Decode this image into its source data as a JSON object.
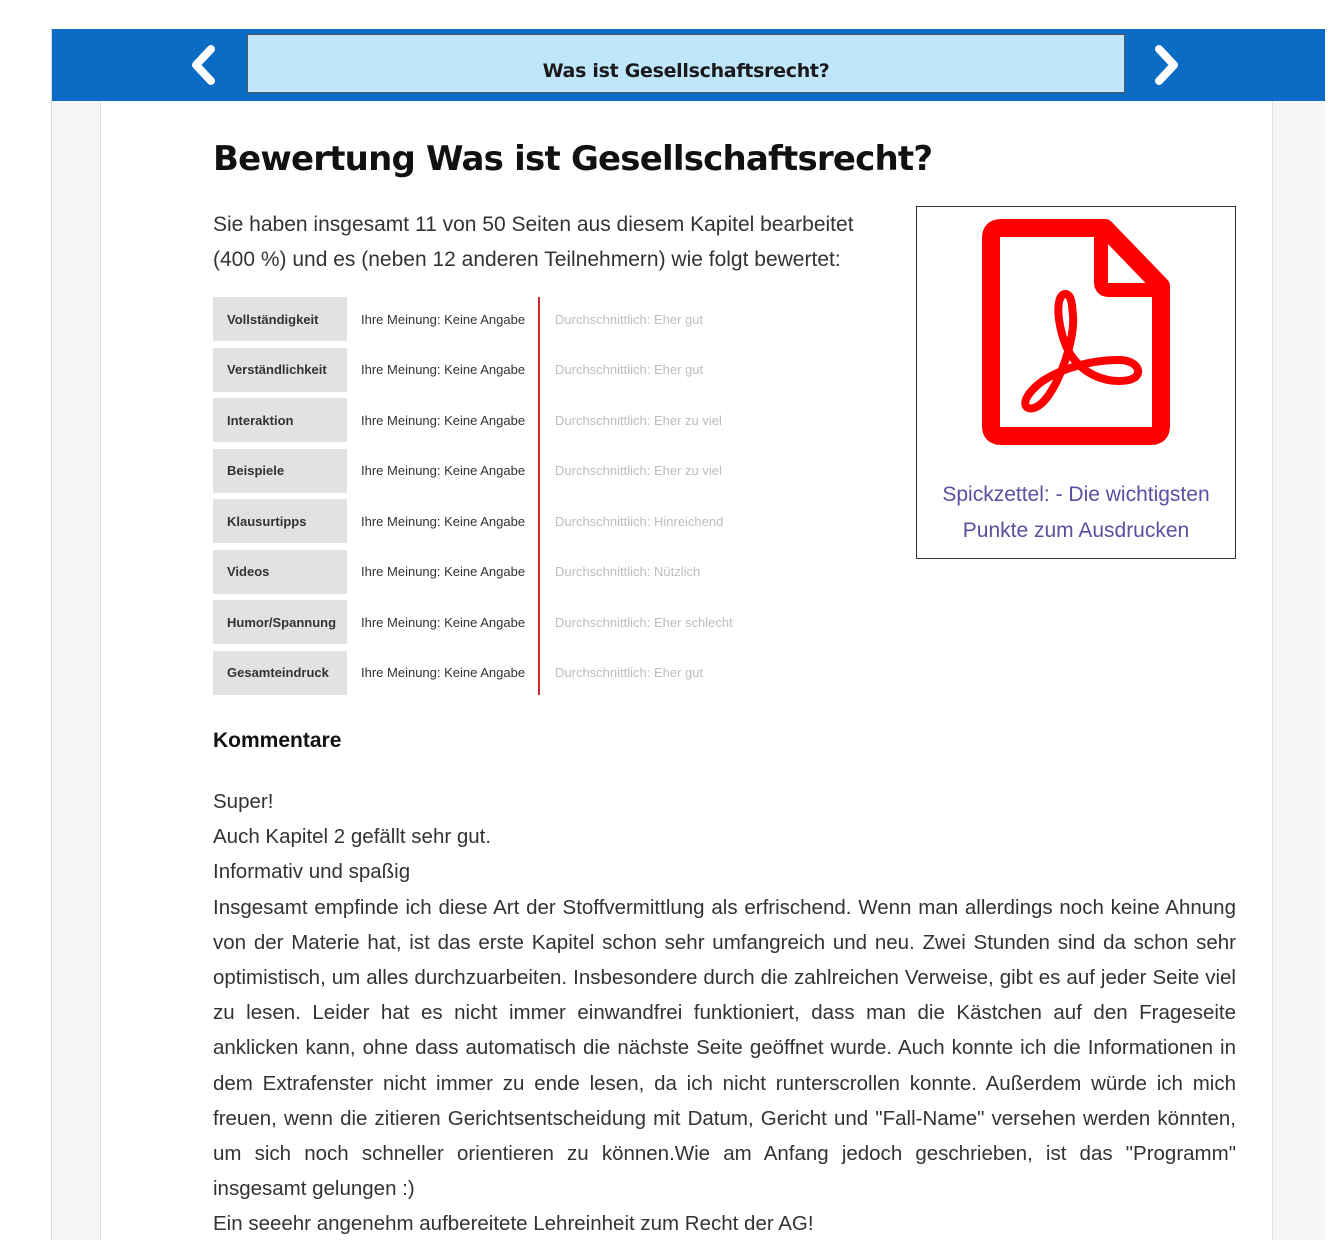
{
  "header": {
    "title": "Was ist Gesellschaftsrecht?",
    "prev_icon": "chevron-left-icon",
    "next_icon": "chevron-right-icon"
  },
  "page": {
    "heading": "Bewertung Was ist Gesellschaftsrecht?",
    "intro": "Sie haben insgesamt 11 von 50 Seiten aus diesem Kapitel bearbeitet (400 %) und es (neben 12 anderen Teilnehmern) wie folgt bewertet:"
  },
  "ratings": [
    {
      "label": "Vollständigkeit",
      "mine": "Ihre Meinung: Keine Angabe",
      "avg": "Durchschnittlich: Eher gut"
    },
    {
      "label": "Verständlichkeit",
      "mine": "Ihre Meinung: Keine Angabe",
      "avg": "Durchschnittlich: Eher gut"
    },
    {
      "label": "Interaktion",
      "mine": "Ihre Meinung: Keine Angabe",
      "avg": "Durchschnittlich: Eher zu viel"
    },
    {
      "label": "Beispiele",
      "mine": "Ihre Meinung: Keine Angabe",
      "avg": "Durchschnittlich: Eher zu viel"
    },
    {
      "label": "Klausurtipps",
      "mine": "Ihre Meinung: Keine Angabe",
      "avg": "Durchschnittlich: Hinreichend"
    },
    {
      "label": "Videos",
      "mine": "Ihre Meinung: Keine Angabe",
      "avg": "Durchschnittlich: Nützlich"
    },
    {
      "label": "Humor/Spannung",
      "mine": "Ihre Meinung: Keine Angabe",
      "avg": "Durchschnittlich: Eher schlecht"
    },
    {
      "label": "Gesamteindruck",
      "mine": "Ihre Meinung: Keine Angabe",
      "avg": "Durchschnittlich: Eher gut"
    }
  ],
  "pdf": {
    "icon": "pdf-file-icon",
    "link_line1": "Spickzettel: - Die wichtigsten",
    "link_line2": "Punkte zum Ausdrucken"
  },
  "comments_section": {
    "heading": "Kommentare",
    "items": [
      "Super!",
      "Auch Kapitel 2 gefällt sehr gut.",
      "Informativ und spaßig",
      "Insgesamt empfinde ich diese Art der Stoffvermittlung als erfrischend. Wenn man allerdings noch keine Ahnung von der Materie hat, ist das erste Kapitel schon sehr umfangreich und neu. Zwei Stunden sind da schon sehr optimistisch, um alles durchzuarbeiten. Insbesondere durch die zahlreichen Verweise, gibt es auf jeder Seite viel zu lesen. Leider hat es nicht immer einwandfrei funktioniert, dass man die Kästchen auf den Frageseite anklicken kann, ohne dass automatisch die nächste Seite geöffnet wurde. Auch konnte ich die Informationen in dem Extrafenster nicht immer zu ende lesen, da ich nicht runterscrollen konnte. Außerdem würde ich mich freuen, wenn die zitieren Gerichtsentscheidung mit Datum, Gericht und \"Fall-Name\" versehen werden könnten, um sich noch schneller orientieren zu können.Wie am Anfang jedoch geschrieben, ist das \"Programm\" insgesamt gelungen :)",
      "Ein seeehr angenehm aufbereitete Lehreinheit zum Recht der AG!"
    ]
  },
  "colors": {
    "topbar": "#0a6cc4",
    "title_box": "#bfe6fb",
    "divider": "#d02a2a",
    "pdf_red": "#ff0000",
    "link": "#5a4fa0"
  }
}
